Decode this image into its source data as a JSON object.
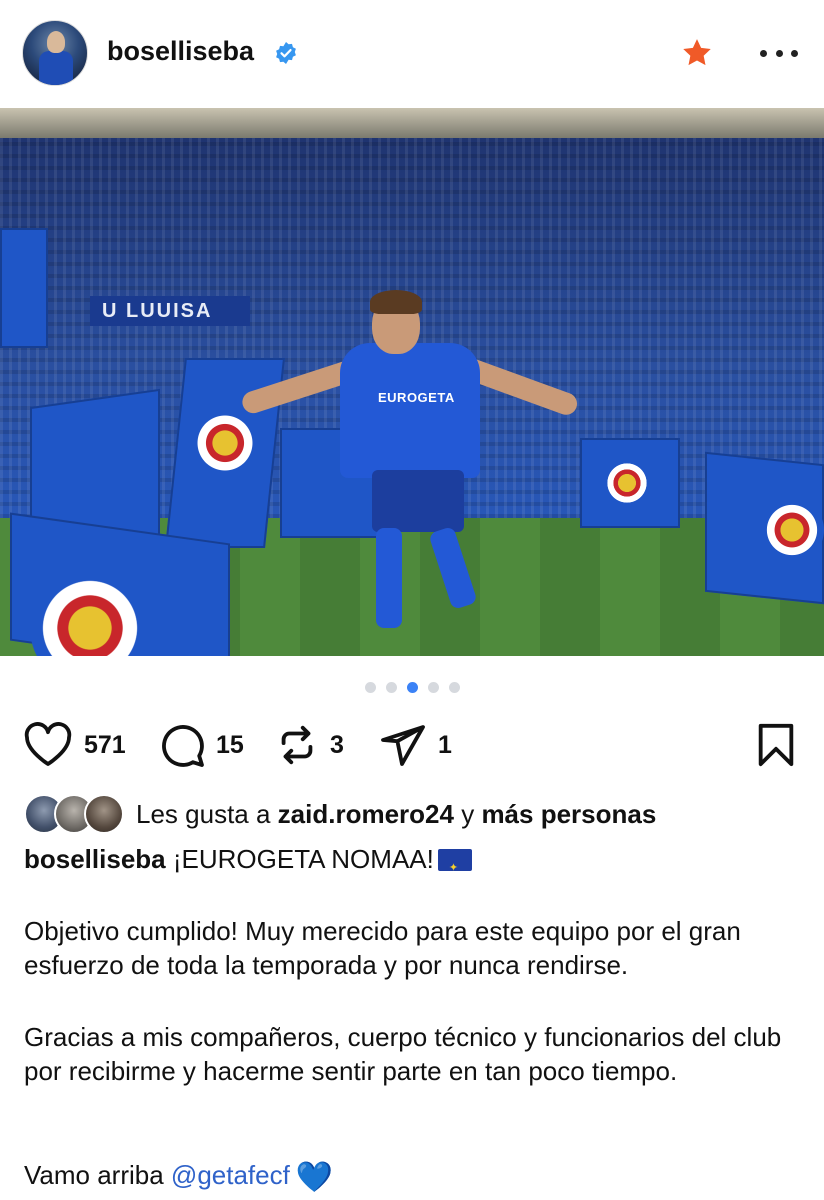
{
  "post": {
    "username": "boselliseba",
    "likes_count": "571",
    "comments_count": "15",
    "reposts_count": "3",
    "shares_count": "1",
    "carousel": {
      "total": 5,
      "active_index": 2
    }
  },
  "photo": {
    "banner_text": "U LUUISA",
    "shirt_sponsor": "EUROGETA"
  },
  "likes": {
    "prefix": "Les gusta a",
    "first_user": "zaid.romero24",
    "conjunction": "y",
    "others": "más personas"
  },
  "caption": {
    "author": "boselliseba",
    "headline": "¡EUROGETA NOMAA!",
    "paragraph1": "Objetivo cumplido! Muy merecido para este equipo por el gran esfuerzo de toda la temporada y por nunca rendirse.",
    "paragraph2": "Gracias a mis compañeros, cuerpo técnico y funcionarios del club por recibirme y hacerme sentir parte en tan poco tiempo.",
    "closing_text": "Vamo arriba",
    "mention": "@getafecf",
    "closing_emoji": "💙"
  },
  "colors": {
    "verified": "#3797f0",
    "star": "#f05a28",
    "dot_active": "#3b82f6",
    "mention": "#2f62c9"
  }
}
